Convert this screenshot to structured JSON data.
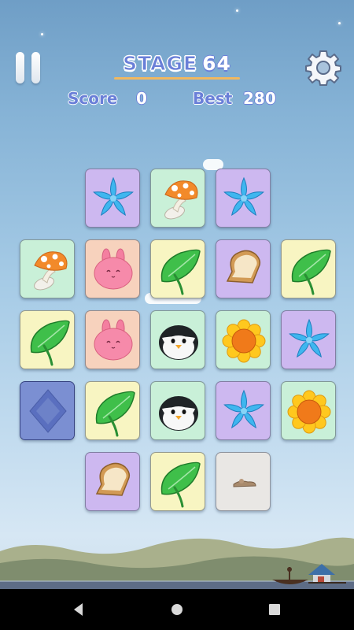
{
  "hud": {
    "stage_label": "STAGE",
    "stage_number": "64",
    "score_label": "Score",
    "score_value": "0",
    "best_label": "Best",
    "best_value": "280"
  },
  "colors": {
    "hud_blue": "#6a7fd8",
    "underline": "#f0b860",
    "tile_purple": "#cdb8f0",
    "tile_green": "#c9f0d8",
    "tile_yellow": "#f8f5c2",
    "tile_peach": "#f7d2bd",
    "tile_blue_selected": "#6f84c8",
    "tile_grey_removed": "#e9e7e4"
  },
  "board": {
    "rows": [
      [
        null,
        "flower-blue",
        "mushroom",
        "flower-blue",
        null
      ],
      [
        "mushroom",
        "bunny-pink",
        "leaf-green",
        "bread",
        "leaf-green"
      ],
      [
        "leaf-green",
        "bunny-pink",
        "penguin",
        "sunflower",
        "flower-blue"
      ],
      [
        "selected-blank",
        "leaf-green",
        "penguin",
        "flower-blue",
        "sunflower"
      ],
      [
        null,
        "bread",
        "leaf-green",
        "removed-crumbs",
        null
      ]
    ]
  },
  "nav": {
    "icons": [
      "back-triangle-icon",
      "home-circle-icon",
      "recents-square-icon"
    ]
  }
}
